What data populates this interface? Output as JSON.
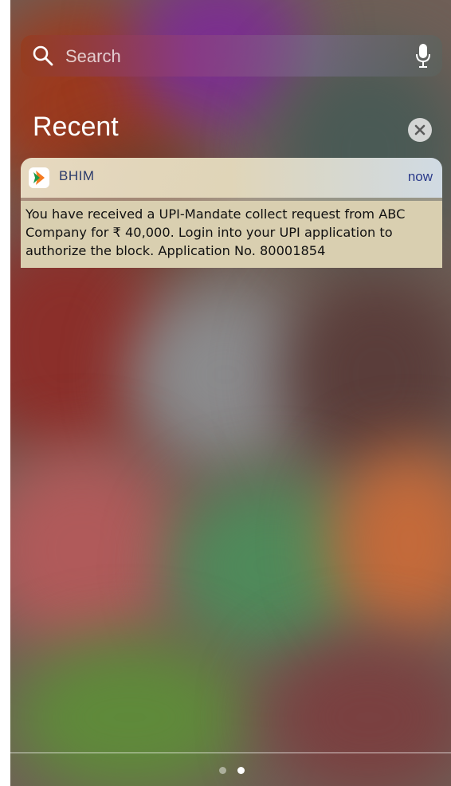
{
  "search": {
    "placeholder": "Search"
  },
  "section": {
    "title": "Recent"
  },
  "notification": {
    "app_name": "BHIM",
    "time": "now",
    "message": "You have received a UPI-Mandate collect request from ABC Company for ₹ 40,000. Login into your UPI application to authorize the block. Application No. 80001854"
  },
  "pager": {
    "total_pages": 2,
    "current_page": 2
  },
  "colors": {
    "app_icon_orange": "#f47a20",
    "app_icon_green": "#1a9a4a",
    "app_name_text": "#2a3a6a",
    "notification_body": "#d9cfb0"
  },
  "icons": {
    "search": "search-icon",
    "mic": "microphone-icon",
    "clear": "close-icon",
    "app": "bhim-logo-icon"
  }
}
